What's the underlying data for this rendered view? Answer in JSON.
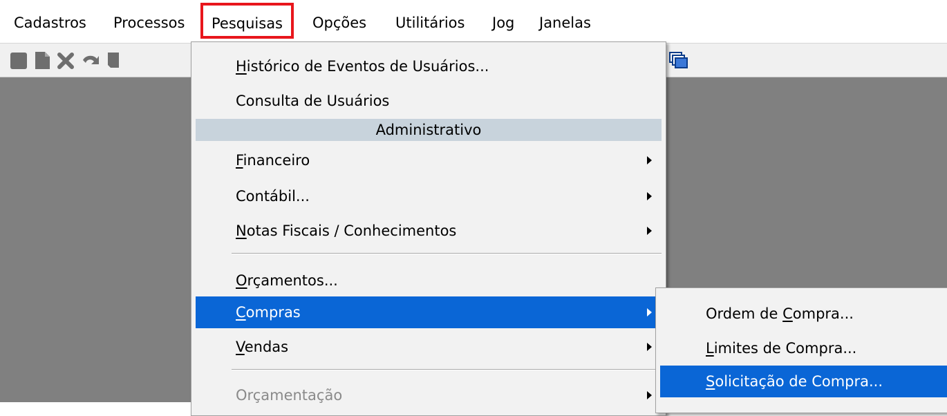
{
  "menubar": {
    "items": [
      {
        "label": "Cadastros"
      },
      {
        "label": "Processos"
      },
      {
        "label": "Pesquisas",
        "active": true
      },
      {
        "label": "Opções"
      },
      {
        "label": "Utilitários"
      },
      {
        "label": "Jog"
      },
      {
        "label": "Janelas"
      }
    ]
  },
  "toolbar": {
    "icons": [
      "save-icon",
      "document-icon",
      "delete-icon",
      "undo-icon",
      "book-icon",
      "window-cascade-icon"
    ]
  },
  "pesquisas_menu": {
    "historico": {
      "pre": "",
      "accel": "H",
      "post": "istórico de Eventos de Usuários..."
    },
    "consulta": {
      "label": "Consulta de Usuários"
    },
    "section_header": "Administrativo",
    "financeiro": {
      "pre": "",
      "accel": "F",
      "post": "inanceiro"
    },
    "contabil": {
      "label": "Contábil..."
    },
    "notas": {
      "pre": "",
      "accel": "N",
      "post": "otas Fiscais / Conhecimentos"
    },
    "orcamentos": {
      "pre": "",
      "accel": "O",
      "post": "rçamentos..."
    },
    "compras": {
      "pre": "",
      "accel": "C",
      "post": "ompras"
    },
    "vendas": {
      "pre": "",
      "accel": "V",
      "post": "endas"
    },
    "orcamentacao": {
      "label": "Orçamentação"
    }
  },
  "compras_submenu": {
    "ordem": {
      "pre": "Ordem de ",
      "accel": "C",
      "post": "ompra..."
    },
    "limites": {
      "pre": "",
      "accel": "L",
      "post": "imites de Compra..."
    },
    "solicitacao": {
      "pre": "",
      "accel": "S",
      "post": "olicitação de Compra..."
    }
  },
  "colors": {
    "highlight": "#0a66d6",
    "active_outline": "#e8161c",
    "workspace": "#808080",
    "section_header": "#c8d3dc"
  }
}
